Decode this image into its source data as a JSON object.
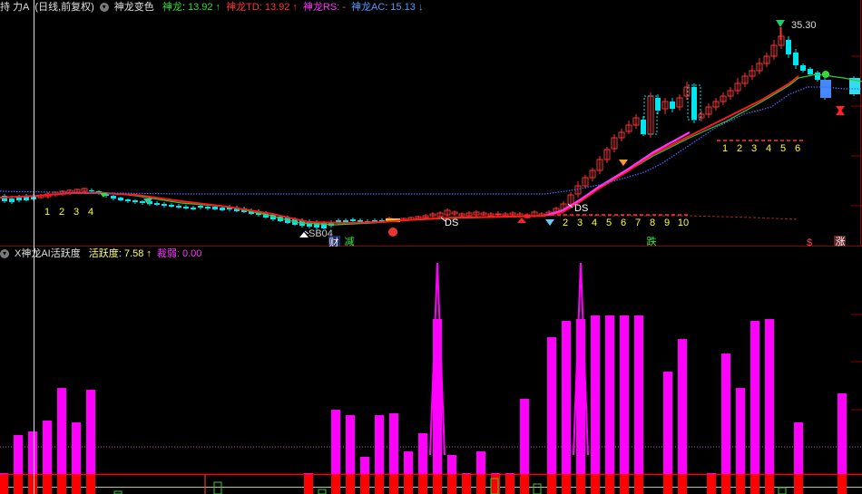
{
  "main_header": {
    "stock_name": "持 力A",
    "period": "(日线,前复权)",
    "indicator": "神龙变色",
    "items": [
      {
        "label": "神龙:",
        "value": "13.92",
        "arrow": "↑",
        "color": "#33dd33"
      },
      {
        "label": "神龙TD:",
        "value": "13.92",
        "arrow": "↑",
        "color": "#ff3333"
      },
      {
        "label": "神龙RS:",
        "value": "-",
        "arrow": "",
        "color": "#ff33ff"
      },
      {
        "label": "神龙AC:",
        "value": "15.13",
        "arrow": "↓",
        "color": "#5599ff"
      }
    ]
  },
  "sub_header": {
    "indicator": "X神龙AI活跃度",
    "items": [
      {
        "label": "活跃度:",
        "value": "7.58",
        "arrow": "↑",
        "color": "#ffff66"
      },
      {
        "label": "裁弱:",
        "value": "0.00",
        "arrow": "",
        "color": "#ff33ff"
      }
    ]
  },
  "price_high_label": "35.30",
  "count_labels": {
    "group1": [
      "1",
      "2",
      "3",
      "4"
    ],
    "group2": [
      "2",
      "3",
      "4",
      "5",
      "6",
      "7",
      "8",
      "9",
      "10"
    ],
    "group3": [
      "1",
      "2",
      "3",
      "4",
      "5",
      "6"
    ]
  },
  "marker_labels": {
    "ds1": "DS",
    "ds2": "DS",
    "code": "SB04",
    "cai": "财",
    "jian": "减",
    "die": "跌",
    "zhang": "涨",
    "dollar": "$"
  },
  "colors": {
    "up": "#ff3333",
    "down": "#00e5ee",
    "td_line": "#ff1a1a",
    "rs_line": "#ff33ff",
    "ac_line": "#4466ff",
    "green_line": "#33cc33",
    "activity_bar": "#ff00ff",
    "base_bar": "#ff0000",
    "count": "#ffff33",
    "dotted": "#cc55cc"
  }
}
